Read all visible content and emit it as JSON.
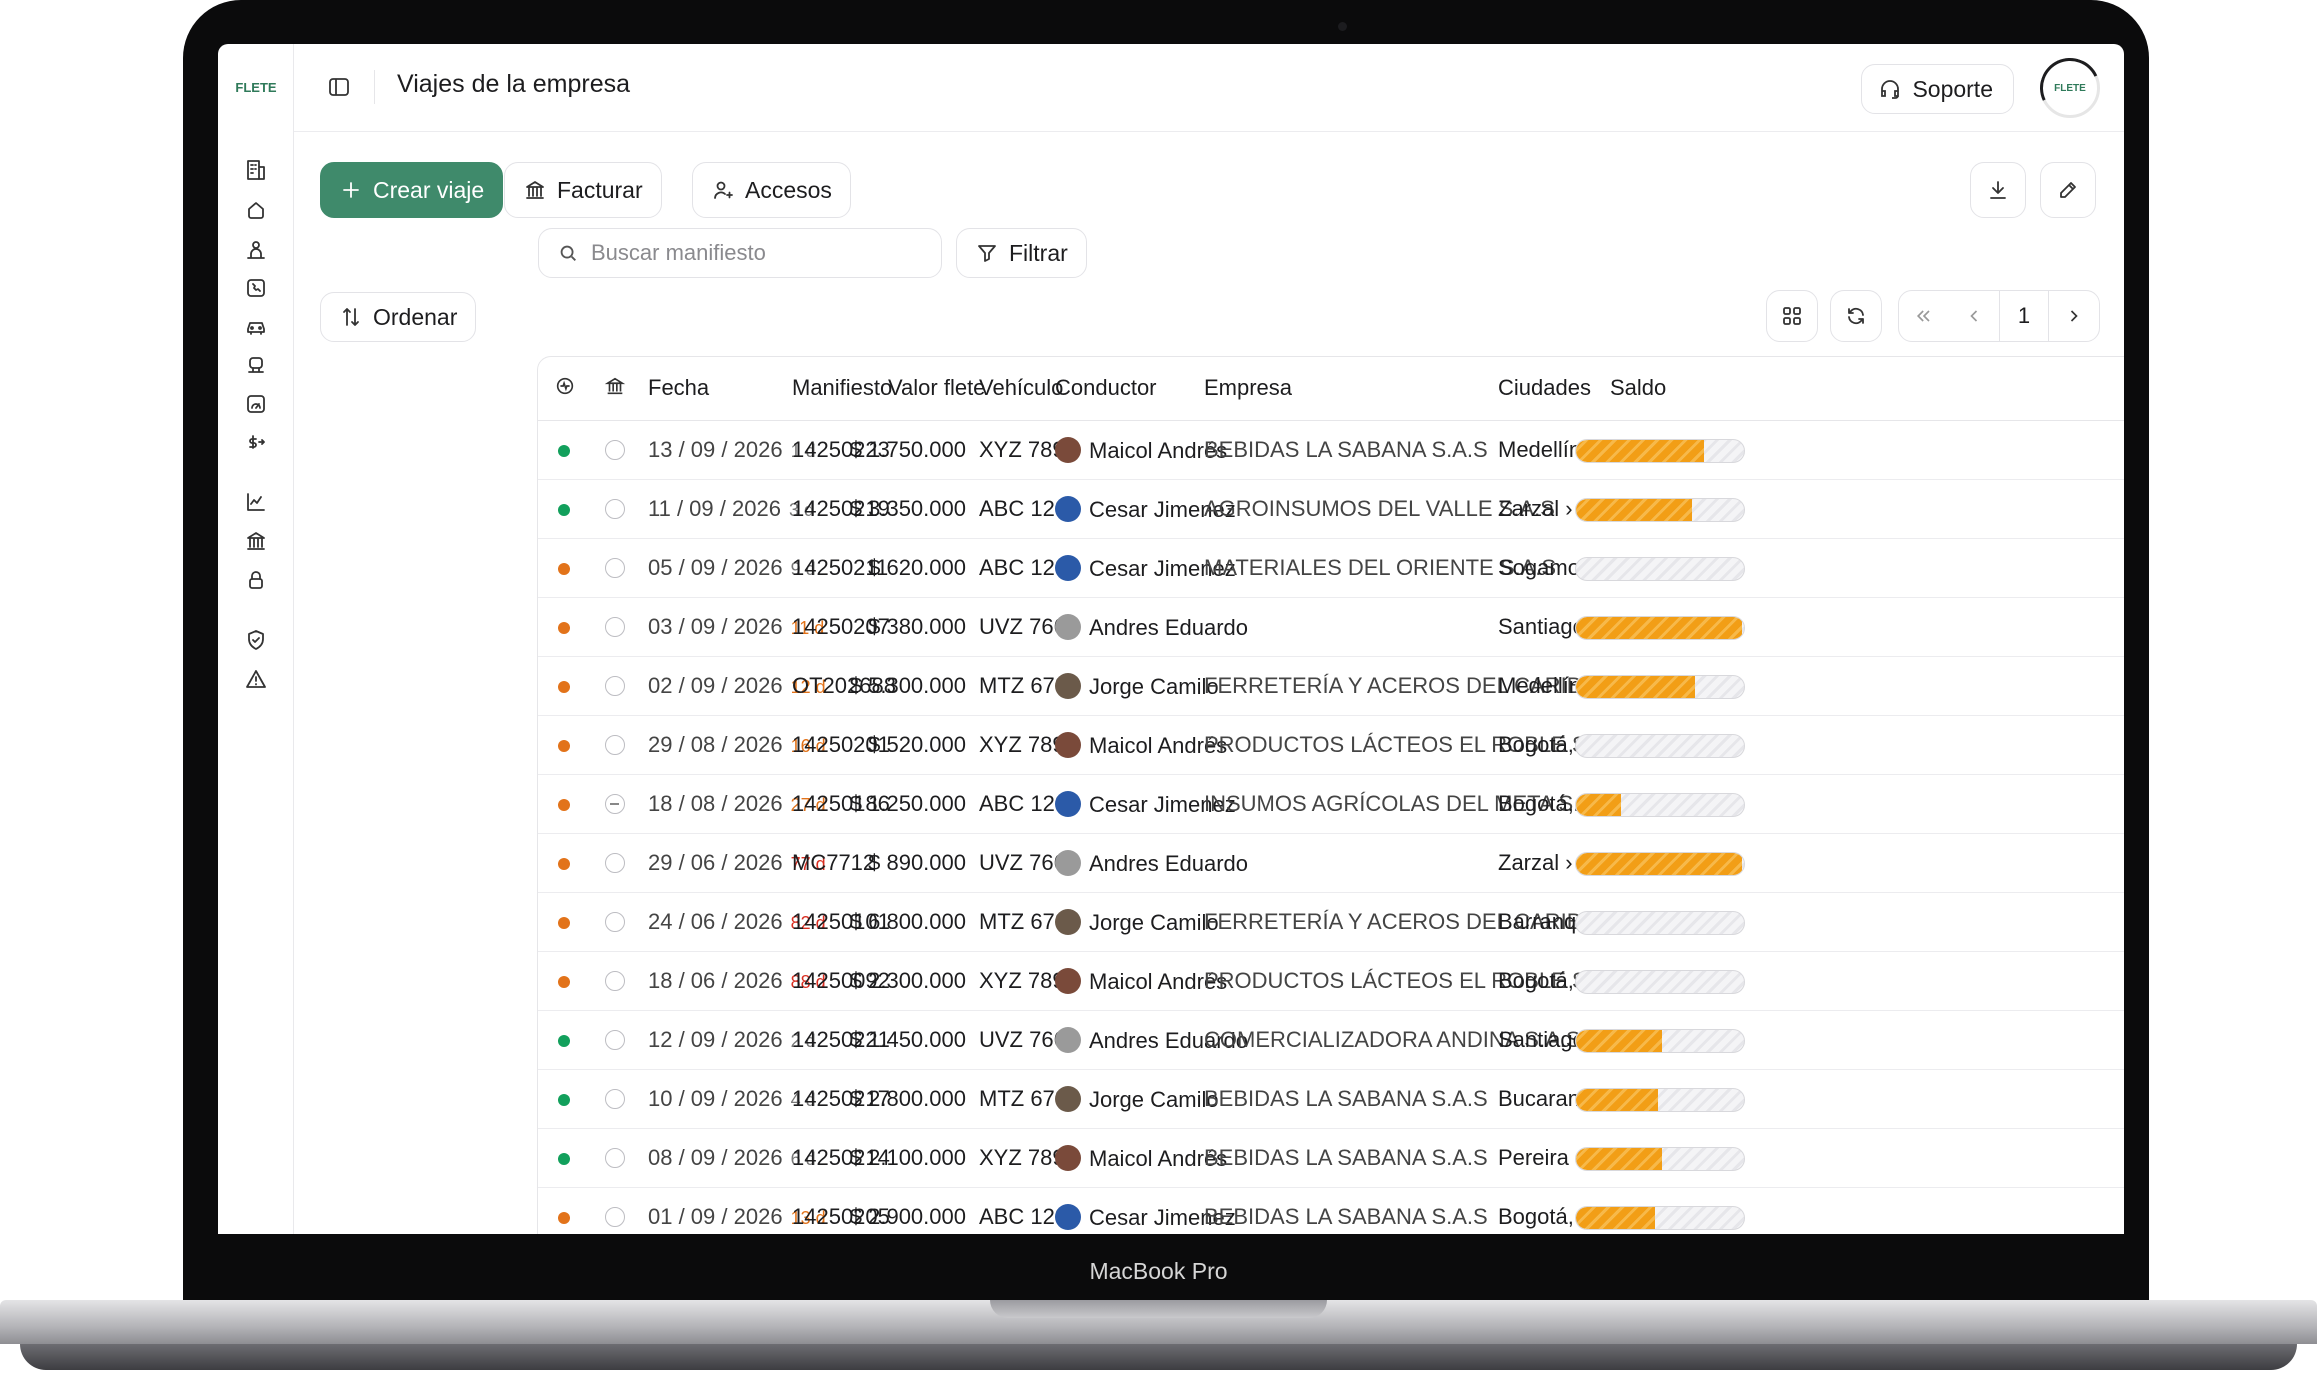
{
  "device": {
    "label": "MacBook Pro"
  },
  "app": {
    "logo": "FLETE",
    "title": "Viajes de la empresa",
    "support": "Soporte",
    "avatar_text": "FLETE"
  },
  "toolbar": {
    "create": "Crear viaje",
    "invoice": "Facturar",
    "access": "Accesos",
    "filter": "Filtrar",
    "sort": "Ordenar",
    "search_placeholder": "Buscar manifiesto",
    "page": "1"
  },
  "columns": [
    "Fecha",
    "Manifiesto",
    "Valor flete",
    "Vehículo",
    "Conductor",
    "Empresa",
    "Ciudades",
    "Saldo"
  ],
  "colors": {
    "accent": "#3f8a6b",
    "green": "#12a05c",
    "orange": "#e2731a",
    "red": "#d92d20",
    "progress": "#f29e16"
  },
  "rows": [
    {
      "status": "green",
      "check": "",
      "date": "13 / 09 / 2026",
      "days": "1 d",
      "days_color": "#777",
      "manifest": "14250223",
      "value": "$ 1.750.000",
      "vehicle": "XYZ 789",
      "driver": "Maicol Andrés",
      "avatar": "#7a4a3a",
      "company": "BEBIDAS LA SABANA S.A.S",
      "cities": "Medellín, Distri",
      "saldo": 76,
      "pct": "76%"
    },
    {
      "status": "green",
      "check": "",
      "date": "11 / 09 / 2026",
      "days": "3 d",
      "days_color": "#777",
      "manifest": "14250219",
      "value": "$ 3.350.000",
      "vehicle": "ABC 123",
      "driver": "Cesar Jimenez",
      "avatar": "#2b5aa8",
      "company": "AGROINSUMOS DEL VALLE S.A.S",
      "cities": "Zarzal  ›  Bogot",
      "saldo": 69,
      "pct": "69%"
    },
    {
      "status": "orange",
      "check": "",
      "date": "05 / 09 / 2026",
      "days": "9 d",
      "days_color": "#777",
      "manifest": "14250211",
      "value": "$ 620.000",
      "vehicle": "ABC 123",
      "driver": "Cesar Jimenez",
      "avatar": "#2b5aa8",
      "company": "MATERIALES DEL ORIENTE S.A.S",
      "cities": "Sogamoso  ›  D",
      "saldo": 0,
      "pct": "0%"
    },
    {
      "status": "orange",
      "check": "",
      "date": "03 / 09 / 2026",
      "days": "11 d",
      "days_color": "#e2731a",
      "manifest": "14250207",
      "value": "$ 380.000",
      "vehicle": "UVZ 766",
      "driver": "Andres Eduardo",
      "avatar": "#9a9a9a",
      "company": "",
      "cities": "Santiago De Ca",
      "saldo": 99,
      "pct": "99%"
    },
    {
      "status": "orange",
      "check": "",
      "date": "02 / 09 / 2026",
      "days": "12 d",
      "days_color": "#e2731a",
      "manifest": "OT202688",
      "value": "$ 5.300.000",
      "vehicle": "MTZ 678",
      "driver": "Jorge Camilo",
      "avatar": "#6b5a4a",
      "company": "FERRETERÍA Y ACEROS DEL CARIBE S.A.S",
      "cities": "Medellín, Distri",
      "saldo": 71,
      "pct": "71%"
    },
    {
      "status": "orange",
      "check": "",
      "date": "29 / 08 / 2026",
      "days": "16 d",
      "days_color": "#e2731a",
      "manifest": "14250201",
      "value": "$ 520.000",
      "vehicle": "XYZ 789",
      "driver": "Maicol Andrés",
      "avatar": "#7a4a3a",
      "company": "PRODUCTOS LÁCTEOS EL ROBLE S.A.S",
      "cities": "Bogotá, Distrito",
      "saldo": 0,
      "pct": "0%"
    },
    {
      "status": "orange",
      "check": "partial",
      "date": "18 / 08 / 2026",
      "days": "27 d",
      "days_color": "#e2731a",
      "manifest": "14250186",
      "value": "$ 1.250.000",
      "vehicle": "ABC 123",
      "driver": "Cesar Jimenez",
      "avatar": "#2b5aa8",
      "company": "INSUMOS AGRÍCOLAS DEL META S.A.S",
      "cities": "Bogotá, Distrito",
      "saldo": 27,
      "pct": "27%"
    },
    {
      "status": "orange",
      "check": "",
      "date": "29 / 06 / 2026",
      "days": "77 d",
      "days_color": "#d92d20",
      "manifest": "MC7712",
      "value": "$ 890.000",
      "vehicle": "UVZ 766",
      "driver": "Andres Eduardo",
      "avatar": "#9a9a9a",
      "company": "",
      "cities": "Zarzal  ›  Pereir",
      "saldo": 99,
      "pct": "99%"
    },
    {
      "status": "orange",
      "check": "",
      "date": "24 / 06 / 2026",
      "days": "82 d",
      "days_color": "#d92d20",
      "manifest": "14250101",
      "value": "$ 6.800.000",
      "vehicle": "MTZ 678",
      "driver": "Jorge Camilo",
      "avatar": "#6b5a4a",
      "company": "FERRETERÍA Y ACEROS DEL CARIBE S.A.S",
      "cities": "Barranquilla, Di",
      "saldo": 0,
      "pct": "0%"
    },
    {
      "status": "orange",
      "check": "",
      "date": "18 / 06 / 2026",
      "days": "88 d",
      "days_color": "#d92d20",
      "manifest": "14250092",
      "value": "$ 2.300.000",
      "vehicle": "XYZ 789",
      "driver": "Maicol Andrés",
      "avatar": "#7a4a3a",
      "company": "PRODUCTOS LÁCTEOS EL ROBLE S.A.S",
      "cities": "Bogotá, Distrito",
      "saldo": 0,
      "pct": "0%"
    },
    {
      "status": "green",
      "check": "",
      "date": "12 / 09 / 2026",
      "days": "2 d",
      "days_color": "#777",
      "manifest": "14250221",
      "value": "$ 1.450.000",
      "vehicle": "UVZ 766",
      "driver": "Andres Eduardo",
      "avatar": "#9a9a9a",
      "company": "COMERCIALIZADORA ANDINA S.A.S",
      "cities": "Santiago De Ca",
      "saldo": 51,
      "pct": "51%"
    },
    {
      "status": "green",
      "check": "",
      "date": "10 / 09 / 2026",
      "days": "4 d",
      "days_color": "#777",
      "manifest": "14250217",
      "value": "$ 2.800.000",
      "vehicle": "MTZ 678",
      "driver": "Jorge Camilo",
      "avatar": "#6b5a4a",
      "company": "BEBIDAS LA SABANA S.A.S",
      "cities": "Bucaramanga  :",
      "saldo": 49,
      "pct": "49%"
    },
    {
      "status": "green",
      "check": "",
      "date": "08 / 09 / 2026",
      "days": "6 d",
      "days_color": "#777",
      "manifest": "14250214",
      "value": "$ 2.100.000",
      "vehicle": "XYZ 789",
      "driver": "Maicol Andrés",
      "avatar": "#7a4a3a",
      "company": "BEBIDAS LA SABANA S.A.S",
      "cities": "Pereira  ›  Med",
      "saldo": 51,
      "pct": "51%"
    },
    {
      "status": "orange",
      "check": "",
      "date": "01 / 09 / 2026",
      "days": "13 d",
      "days_color": "#e2731a",
      "manifest": "14250205",
      "value": "$ 2.900.000",
      "vehicle": "ABC 123",
      "driver": "Cesar Jimenez",
      "avatar": "#2b5aa8",
      "company": "BEBIDAS LA SABANA S.A.S",
      "cities": "Bogotá, Distrito",
      "saldo": 47,
      "pct": "47%"
    }
  ]
}
